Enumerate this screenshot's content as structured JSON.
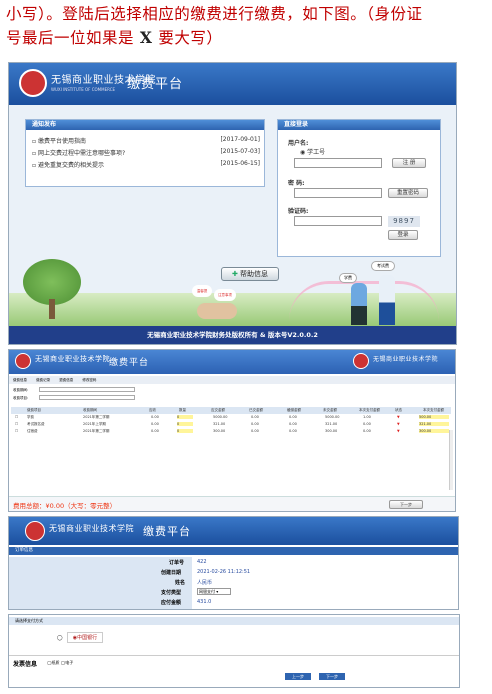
{
  "intro": {
    "line1_a": "小写）。登陆后选择相应的缴费进行缴费，如下图。（身份证",
    "line2_a": "号最后一位如果是",
    "line2_x": " X ",
    "line2_b": "要大写）"
  },
  "login_page": {
    "school_name": "无锡商业职业技术学院",
    "school_name_en": "WUXI INSTITUTE OF COMMERCE",
    "portal_title": "缴费平台",
    "notice_header": "通知发布",
    "notices": [
      {
        "title": "缴费平台使用指南",
        "date": "[2017-09-01]"
      },
      {
        "title": "网上交费过程中需注意哪些事项?",
        "date": "[2015-07-03]"
      },
      {
        "title": "避免重复交费的相关提示",
        "date": "[2015-06-15]"
      }
    ],
    "login_header": "直接登录",
    "username_label": "用户名:",
    "radio_label": "学工号",
    "register_button": "注 册",
    "password_label": "密 码:",
    "reset_password_button": "重置密码",
    "captcha_label": "验证码:",
    "captcha_text": "9897",
    "login_button": "登录",
    "help_button": "帮助信息",
    "cloud_left": "温馨提",
    "cloud_right": "注意事项",
    "bubble_1": "学费",
    "bubble_2": "考试费",
    "footer": "无锡商业职业技术学院财务处版权所有 & 版本号V2.0.0.2"
  },
  "payment_list_page": {
    "portal_title": "缴费平台",
    "tabs": [
      "缴费信息",
      "缴费记录",
      "退费信息",
      "修改密码"
    ],
    "filter_label_1": "收费期间:",
    "filter_label_2": "收费项目:",
    "columns": [
      "缴费项目",
      "收费期间",
      "应收",
      "数量",
      "应交金额",
      "已交金额",
      "缓缴金额",
      "未交金额",
      "本次支付金额",
      "状态",
      "本次支付金额"
    ],
    "rows": [
      {
        "name": "学费",
        "period": "2021年第二学期",
        "a": "0.00",
        "b": "0",
        "c": "5000.00",
        "d": "0.00",
        "e": "0.00",
        "f": "5000.00",
        "g": "1.00",
        "h": "500.00"
      },
      {
        "name": "考试报名费",
        "period": "2021年上学期",
        "a": "0.00",
        "b": "0",
        "c": "321.00",
        "d": "0.00",
        "e": "0.00",
        "f": "321.00",
        "g": "0.00",
        "h": "321.00"
      },
      {
        "name": "住宿费",
        "period": "2021年第二学期",
        "a": "0.00",
        "b": "0",
        "c": "300.00",
        "d": "0.00",
        "e": "0.00",
        "f": "300.00",
        "g": "0.00",
        "h": "300.00"
      }
    ],
    "total_label": "费用总额：",
    "total_value": "¥0.00（大写：零元整）",
    "pay_button": "下一步"
  },
  "order_page": {
    "portal_title": "缴费平台",
    "section": "订单信息",
    "fields": [
      {
        "label": "订单号",
        "value": "422"
      },
      {
        "label": "创建日期",
        "value": "2021-02-26 11:12:51"
      },
      {
        "label": "姓名",
        "value": "人民币"
      },
      {
        "label": "支付类型",
        "value": "网银支付"
      },
      {
        "label": "应付金额",
        "value": "431.0"
      }
    ]
  },
  "bank_page": {
    "section": "请选择支付方式",
    "bank_name": "中国银行",
    "info_label": "发票信息",
    "info_value_1": "纸质",
    "info_value_2": "电子",
    "prev_button": "上一步",
    "next_button": "下一步"
  },
  "colors": {
    "intro_red": "#c00000",
    "header_blue": "#2c61b3",
    "footer_navy": "#213f8a",
    "total_red": "#e31"
  }
}
